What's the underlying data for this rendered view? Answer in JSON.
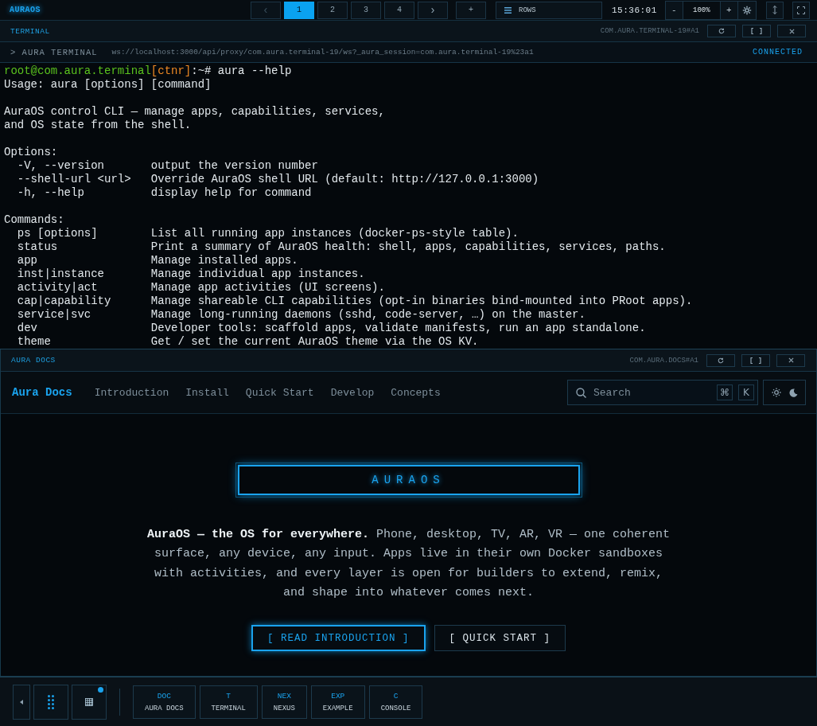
{
  "topbar": {
    "logo": "AURAOS",
    "pager": [
      {
        "label": "‹",
        "kind": "nav",
        "disabled": true,
        "selected": false
      },
      {
        "label": "1",
        "kind": "page",
        "disabled": false,
        "selected": true
      },
      {
        "label": "2",
        "kind": "page",
        "disabled": false,
        "selected": false
      },
      {
        "label": "3",
        "kind": "page",
        "disabled": false,
        "selected": false
      },
      {
        "label": "4",
        "kind": "page",
        "disabled": false,
        "selected": false
      },
      {
        "label": "›",
        "kind": "nav",
        "disabled": false,
        "selected": false
      }
    ],
    "add_label": "+",
    "layout": "ROWS",
    "clock": "15:36:01",
    "zoom_out": "-",
    "zoom": "100%",
    "zoom_in": "+"
  },
  "terminal": {
    "title": "TERMINAL",
    "instance": "COM.AURA.TERMINAL-19#A1",
    "name": "> AURA TERMINAL",
    "url": "ws://localhost:3000/api/proxy/com.aura.terminal-19/ws?_aura_session=com.aura.terminal-19%23a1",
    "status": "CONNECTED",
    "lines": [
      {
        "kind": "prompt",
        "user": "root@com.aura.terminal",
        "container": "[ctnr]",
        "text": ":~# aura --help"
      },
      {
        "kind": "out",
        "text": "Usage: aura [options] [command]"
      },
      {
        "kind": "blank"
      },
      {
        "kind": "out",
        "text": "AuraOS control CLI — manage apps, capabilities, services,"
      },
      {
        "kind": "out",
        "text": "and OS state from the shell."
      },
      {
        "kind": "blank"
      },
      {
        "kind": "out",
        "text": "Options:"
      },
      {
        "kind": "out",
        "text": "  -V, --version       output the version number"
      },
      {
        "kind": "out",
        "text": "  --shell-url <url>   Override AuraOS shell URL (default: http://127.0.0.1:3000)"
      },
      {
        "kind": "out",
        "text": "  -h, --help          display help for command"
      },
      {
        "kind": "blank"
      },
      {
        "kind": "out",
        "text": "Commands:"
      },
      {
        "kind": "out",
        "text": "  ps [options]        List all running app instances (docker-ps-style table)."
      },
      {
        "kind": "out",
        "text": "  status              Print a summary of AuraOS health: shell, apps, capabilities, services, paths."
      },
      {
        "kind": "out",
        "text": "  app                 Manage installed apps."
      },
      {
        "kind": "out",
        "text": "  inst|instance       Manage individual app instances."
      },
      {
        "kind": "out",
        "text": "  activity|act        Manage app activities (UI screens)."
      },
      {
        "kind": "out",
        "text": "  cap|capability      Manage shareable CLI capabilities (opt-in binaries bind-mounted into PRoot apps)."
      },
      {
        "kind": "out",
        "text": "  service|svc         Manage long-running daemons (sshd, code-server, …) on the master."
      },
      {
        "kind": "out",
        "text": "  dev                 Developer tools: scaffold apps, validate manifests, run an app standalone."
      },
      {
        "kind": "out",
        "text": "  theme               Get / set the current AuraOS theme via the OS KV."
      }
    ]
  },
  "docs": {
    "title": "AURA DOCS",
    "instance": "COM.AURA.DOCS#A1",
    "brand": "Aura Docs",
    "nav": [
      "Introduction",
      "Install",
      "Quick Start",
      "Develop",
      "Concepts"
    ],
    "search": {
      "placeholder": "Search",
      "keys": [
        "⌘",
        "K"
      ]
    },
    "hero": {
      "badge": "AURAOS",
      "text": "**AuraOS — the OS for everywhere.** Phone, desktop, TV, AR, VR — one coherent surface, any device, any input. Apps live in their own Docker sandboxes with activities, and every layer is open for builders to extend, remix, and shape into whatever comes next.",
      "buttons": [
        {
          "label": "[ READ INTRODUCTION ]",
          "kind": "primary"
        },
        {
          "label": "[ QUICK START ]",
          "kind": "secondary"
        }
      ]
    }
  },
  "dock": {
    "grid_badge": true,
    "apps": [
      {
        "code": "DOC",
        "name": "AURA DOCS"
      },
      {
        "code": "T",
        "name": "TERMINAL"
      },
      {
        "code": "NEX",
        "name": "NEXUS"
      },
      {
        "code": "EXP",
        "name": "EXAMPLE"
      },
      {
        "code": "C",
        "name": "CONSOLE"
      }
    ]
  }
}
